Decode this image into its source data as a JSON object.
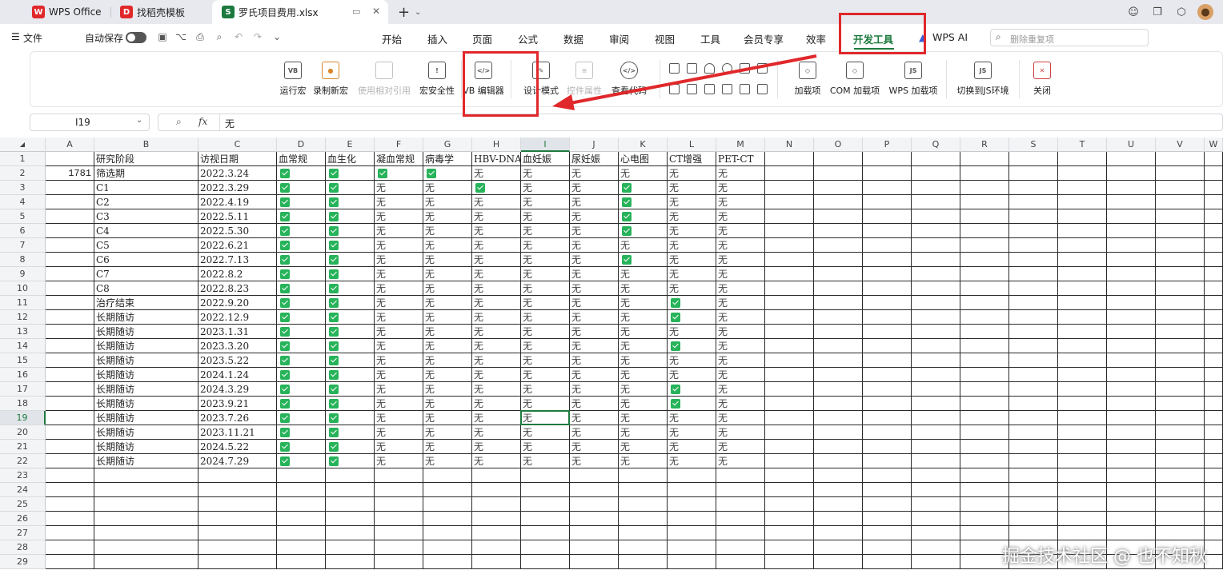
{
  "tabs": [
    {
      "label": "WPS Office",
      "icon": "wps-logo-icon",
      "color": "#e0282b"
    },
    {
      "label": "找稻壳模板",
      "icon": "docer-icon",
      "color": "#e0282b"
    },
    {
      "label": "罗氏项目费用.xlsx",
      "icon": "sheet-icon",
      "color": "#1d7a3e"
    }
  ],
  "menu": {
    "file": "文件",
    "autosave": "自动保存",
    "tabs": [
      "开始",
      "插入",
      "页面",
      "公式",
      "数据",
      "审阅",
      "视图",
      "工具",
      "会员专享",
      "效率",
      "开发工具",
      "WPS AI"
    ],
    "active_tab": "开发工具",
    "search_placeholder": "删除重复项"
  },
  "ribbon": {
    "buttons": [
      {
        "label": "运行宏",
        "icon": "run-macro-icon",
        "glyph": "VB",
        "disabled": false
      },
      {
        "label": "录制新宏",
        "icon": "record-macro-icon",
        "glyph": "●",
        "disabled": false
      },
      {
        "label": "使用相对引用",
        "icon": "relative-ref-icon",
        "glyph": "",
        "disabled": true
      },
      {
        "label": "宏安全性",
        "icon": "macro-security-icon",
        "glyph": "!",
        "disabled": false
      },
      {
        "label": "VB 编辑器",
        "icon": "vb-editor-icon",
        "glyph": "</>",
        "disabled": false
      },
      {
        "label": "设计模式",
        "icon": "design-mode-icon",
        "glyph": "✎",
        "disabled": false
      },
      {
        "label": "控件属性",
        "icon": "control-props-icon",
        "glyph": "≡",
        "disabled": true
      },
      {
        "label": "查看代码",
        "icon": "view-code-icon",
        "glyph": "</>",
        "disabled": false
      },
      {
        "label": "加载项",
        "icon": "addin-icon",
        "glyph": "◇",
        "disabled": false
      },
      {
        "label": "COM 加载项",
        "icon": "com-addin-icon",
        "glyph": "◇",
        "disabled": false
      },
      {
        "label": "WPS 加载项",
        "icon": "wps-addin-icon",
        "glyph": "JS",
        "disabled": false
      },
      {
        "label": "切换到JS环境",
        "icon": "js-env-icon",
        "glyph": "JS",
        "disabled": false
      },
      {
        "label": "关闭",
        "icon": "close-icon",
        "glyph": "✕",
        "disabled": false
      }
    ]
  },
  "formula_bar": {
    "cell_ref": "I19",
    "fx": "fx",
    "content": "无"
  },
  "grid": {
    "columns": [
      "A",
      "B",
      "C",
      "D",
      "E",
      "F",
      "G",
      "H",
      "I",
      "J",
      "K",
      "L",
      "M",
      "N",
      "O",
      "P",
      "Q",
      "R",
      "S",
      "T",
      "U",
      "V",
      "W"
    ],
    "selected_col": "I",
    "selected_row": 19,
    "header": [
      "",
      "研究阶段",
      "访视日期",
      "血常规",
      "血生化",
      "凝血常规",
      "病毒学",
      "HBV-DNA",
      "血妊娠",
      "尿妊娠",
      "心电图",
      "CT增强",
      "PET-CT"
    ],
    "rows": [
      [
        "1781",
        "筛选期",
        "2022.3.24",
        "✓",
        "✓",
        "✓",
        "✓",
        "无",
        "无",
        "无",
        "无",
        "无",
        "无"
      ],
      [
        "",
        "C1",
        "2022.3.29",
        "✓",
        "✓",
        "无",
        "无",
        "✓",
        "无",
        "无",
        "✓",
        "无",
        "无"
      ],
      [
        "",
        "C2",
        "2022.4.19",
        "✓",
        "✓",
        "无",
        "无",
        "无",
        "无",
        "无",
        "✓",
        "无",
        "无"
      ],
      [
        "",
        "C3",
        "2022.5.11",
        "✓",
        "✓",
        "无",
        "无",
        "无",
        "无",
        "无",
        "✓",
        "无",
        "无"
      ],
      [
        "",
        "C4",
        "2022.5.30",
        "✓",
        "✓",
        "无",
        "无",
        "无",
        "无",
        "无",
        "✓",
        "无",
        "无"
      ],
      [
        "",
        "C5",
        "2022.6.21",
        "✓",
        "✓",
        "无",
        "无",
        "无",
        "无",
        "无",
        "无",
        "无",
        "无"
      ],
      [
        "",
        "C6",
        "2022.7.13",
        "✓",
        "✓",
        "无",
        "无",
        "无",
        "无",
        "无",
        "✓",
        "无",
        "无"
      ],
      [
        "",
        "C7",
        "2022.8.2",
        "✓",
        "✓",
        "无",
        "无",
        "无",
        "无",
        "无",
        "无",
        "无",
        "无"
      ],
      [
        "",
        "C8",
        "2022.8.23",
        "✓",
        "✓",
        "无",
        "无",
        "无",
        "无",
        "无",
        "无",
        "无",
        "无"
      ],
      [
        "",
        "治疗结束",
        "2022.9.20",
        "✓",
        "✓",
        "无",
        "无",
        "无",
        "无",
        "无",
        "无",
        "✓",
        "无"
      ],
      [
        "",
        "长期随访",
        "2022.12.9",
        "✓",
        "✓",
        "无",
        "无",
        "无",
        "无",
        "无",
        "无",
        "✓",
        "无"
      ],
      [
        "",
        "长期随访",
        "2023.1.31",
        "✓",
        "✓",
        "无",
        "无",
        "无",
        "无",
        "无",
        "无",
        "无",
        "无"
      ],
      [
        "",
        "长期随访",
        "2023.3.20",
        "✓",
        "✓",
        "无",
        "无",
        "无",
        "无",
        "无",
        "无",
        "✓",
        "无"
      ],
      [
        "",
        "长期随访",
        "2023.5.22",
        "✓",
        "✓",
        "无",
        "无",
        "无",
        "无",
        "无",
        "无",
        "无",
        "无"
      ],
      [
        "",
        "长期随访",
        "2024.1.24",
        "✓",
        "✓",
        "无",
        "无",
        "无",
        "无",
        "无",
        "无",
        "无",
        "无"
      ],
      [
        "",
        "长期随访",
        "2024.3.29",
        "✓",
        "✓",
        "无",
        "无",
        "无",
        "无",
        "无",
        "无",
        "✓",
        "无"
      ],
      [
        "",
        "长期随访",
        "2023.9.21",
        "✓",
        "✓",
        "无",
        "无",
        "无",
        "无",
        "无",
        "无",
        "✓",
        "无"
      ],
      [
        "",
        "长期随访",
        "2023.7.26",
        "✓",
        "✓",
        "无",
        "无",
        "无",
        "无",
        "无",
        "无",
        "无",
        "无"
      ],
      [
        "",
        "长期随访",
        "2023.11.21",
        "✓",
        "✓",
        "无",
        "无",
        "无",
        "无",
        "无",
        "无",
        "无",
        "无"
      ],
      [
        "",
        "长期随访",
        "2024.5.22",
        "✓",
        "✓",
        "无",
        "无",
        "无",
        "无",
        "无",
        "无",
        "无",
        "无"
      ],
      [
        "",
        "长期随访",
        "2024.7.29",
        "✓",
        "✓",
        "无",
        "无",
        "无",
        "无",
        "无",
        "无",
        "无",
        "无"
      ]
    ],
    "row_numbers": [
      "1",
      "2",
      "3",
      "4",
      "5",
      "6",
      "7",
      "8",
      "9",
      "10",
      "11",
      "12",
      "13",
      "14",
      "15",
      "16",
      "17",
      "18",
      "19",
      "20",
      "21",
      "22",
      "23",
      "24",
      "25",
      "26",
      "27",
      "28",
      "29",
      "30"
    ]
  },
  "watermark": "掘金技术社区 @ 也不知秋",
  "colors": {
    "accent": "#1d7a3e",
    "check": "#27b35a",
    "annotation": "#e0282b"
  }
}
